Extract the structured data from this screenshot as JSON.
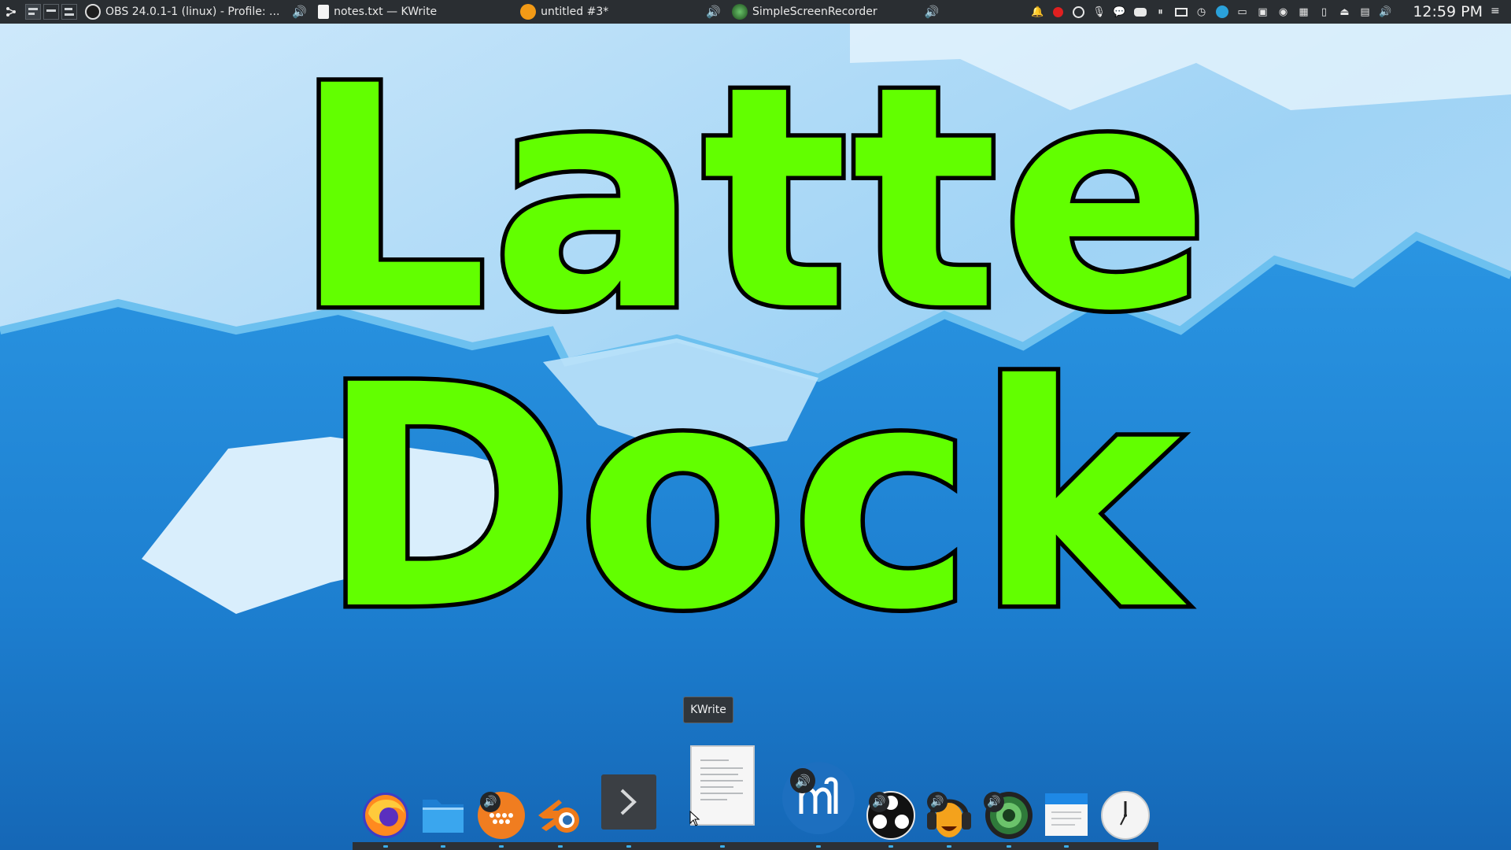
{
  "top_panel": {
    "tasks": [
      {
        "label": "OBS 24.0.1-1 (linux) - Profile: ...",
        "icon": "obs-icon",
        "has_audio": true
      },
      {
        "label": "notes.txt  — KWrite",
        "icon": "document-icon",
        "has_audio": false
      },
      {
        "label": "untitled #3*",
        "icon": "audacity-icon",
        "has_audio": true
      },
      {
        "label": "SimpleScreenRecorder",
        "icon": "ssr-icon",
        "has_audio": true
      }
    ],
    "audio_glyph": "🔊",
    "clock": "12:59 PM",
    "tray_icons": [
      "notifications-icon",
      "record-icon",
      "obs-tray-icon",
      "microphone-icon",
      "chat-icon",
      "discord-icon",
      "pause-icon",
      "screen-icon",
      "clock-icon",
      "telegram-icon",
      "display-icon",
      "clipboard-icon",
      "network-icon",
      "keyboard-icon",
      "battery-icon",
      "usb-icon",
      "notes-icon",
      "volume-icon"
    ]
  },
  "title": {
    "line1": "Latte",
    "line2": "Dock"
  },
  "dock": {
    "tooltip": "KWrite",
    "items": [
      "firefox-icon",
      "files-icon",
      "mixxx-icon",
      "blender-icon",
      "terminal-icon",
      "kwrite-icon",
      "musescore-icon",
      "obs-icon",
      "audacity-icon",
      "ssr-icon",
      "calendar-icon",
      "clock-icon"
    ]
  },
  "colors": {
    "title_fill": "#62ff00",
    "panel_bg": "#2a2e32",
    "accent": "#3daee9"
  }
}
